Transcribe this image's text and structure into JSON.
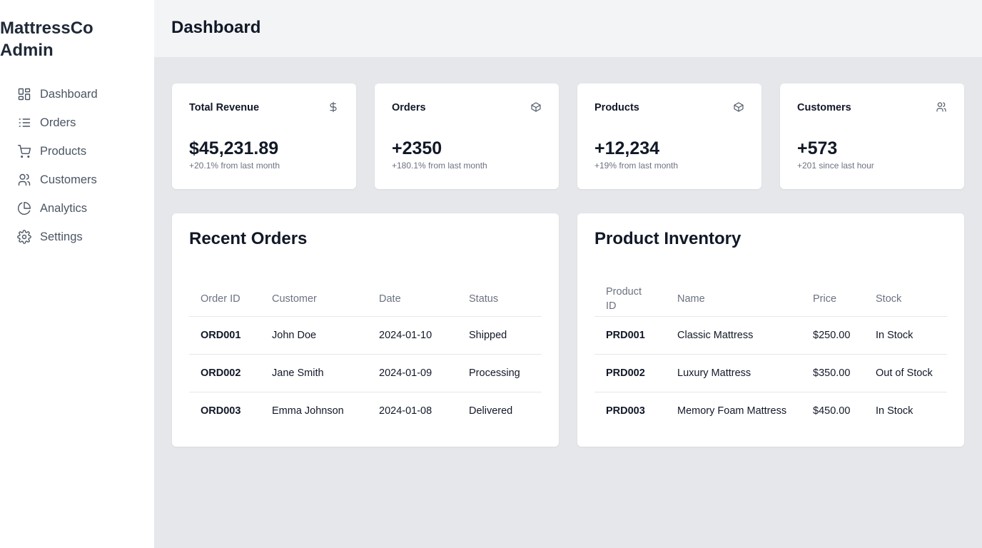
{
  "brand": {
    "line1": "MattressCo",
    "line2": "Admin"
  },
  "nav": [
    {
      "label": "Dashboard",
      "icon": "dashboard-icon"
    },
    {
      "label": "Orders",
      "icon": "list-icon"
    },
    {
      "label": "Products",
      "icon": "cart-icon"
    },
    {
      "label": "Customers",
      "icon": "users-icon"
    },
    {
      "label": "Analytics",
      "icon": "pie-chart-icon"
    },
    {
      "label": "Settings",
      "icon": "gear-icon"
    }
  ],
  "header": {
    "title": "Dashboard"
  },
  "stats": [
    {
      "title": "Total Revenue",
      "value": "$45,231.89",
      "sub": "+20.1% from last month",
      "icon": "dollar-icon"
    },
    {
      "title": "Orders",
      "value": "+2350",
      "sub": "+180.1% from last month",
      "icon": "box-icon"
    },
    {
      "title": "Products",
      "value": "+12,234",
      "sub": "+19% from last month",
      "icon": "box-icon"
    },
    {
      "title": "Customers",
      "value": "+573",
      "sub": "+201 since last hour",
      "icon": "users-icon"
    }
  ],
  "recent_orders": {
    "title": "Recent Orders",
    "columns": [
      "Order ID",
      "Customer",
      "Date",
      "Status"
    ],
    "rows": [
      [
        "ORD001",
        "John Doe",
        "2024-01-10",
        "Shipped"
      ],
      [
        "ORD002",
        "Jane Smith",
        "2024-01-09",
        "Processing"
      ],
      [
        "ORD003",
        "Emma Johnson",
        "2024-01-08",
        "Delivered"
      ]
    ]
  },
  "inventory": {
    "title": "Product Inventory",
    "columns": [
      "Product ID",
      "Name",
      "Price",
      "Stock"
    ],
    "rows": [
      [
        "PRD001",
        "Classic Mattress",
        "$250.00",
        "In Stock"
      ],
      [
        "PRD002",
        "Luxury Mattress",
        "$350.00",
        "Out of Stock"
      ],
      [
        "PRD003",
        "Memory Foam Mattress",
        "$450.00",
        "In Stock"
      ]
    ]
  }
}
